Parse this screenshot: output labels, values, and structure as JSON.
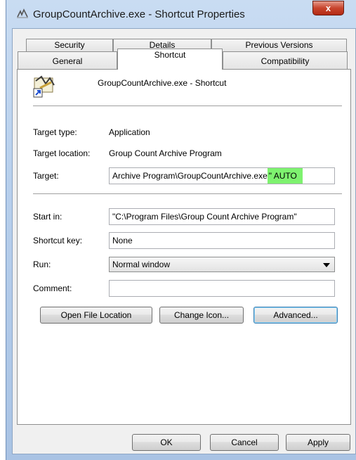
{
  "window": {
    "title": "GroupCountArchive.exe - Shortcut Properties",
    "close_label": "x"
  },
  "tabs": {
    "row1": [
      "Security",
      "Details",
      "Previous Versions"
    ],
    "row2": [
      "General",
      "Shortcut",
      "Compatibility"
    ],
    "active": "Shortcut"
  },
  "header": {
    "shortcut_name": "GroupCountArchive.exe - Shortcut"
  },
  "fields": {
    "target_type_label": "Target type:",
    "target_type_value": "Application",
    "target_location_label": "Target location:",
    "target_location_value": "Group Count Archive Program",
    "target_label": "Target:",
    "target_value_main": "Archive Program\\GroupCountArchive.exe",
    "target_value_highlight": "\" AUTO",
    "start_in_label": "Start in:",
    "start_in_value": "\"C:\\Program Files\\Group Count Archive Program\"",
    "shortcut_key_label": "Shortcut key:",
    "shortcut_key_value": "None",
    "run_label": "Run:",
    "run_value": "Normal window",
    "comment_label": "Comment:",
    "comment_value": ""
  },
  "buttons": {
    "open_file_location": "Open File Location",
    "change_icon": "Change Icon...",
    "advanced": "Advanced...",
    "ok": "OK",
    "cancel": "Cancel",
    "apply": "Apply"
  },
  "colors": {
    "highlight": "#7ef26f",
    "close_button": "#c8442d"
  }
}
